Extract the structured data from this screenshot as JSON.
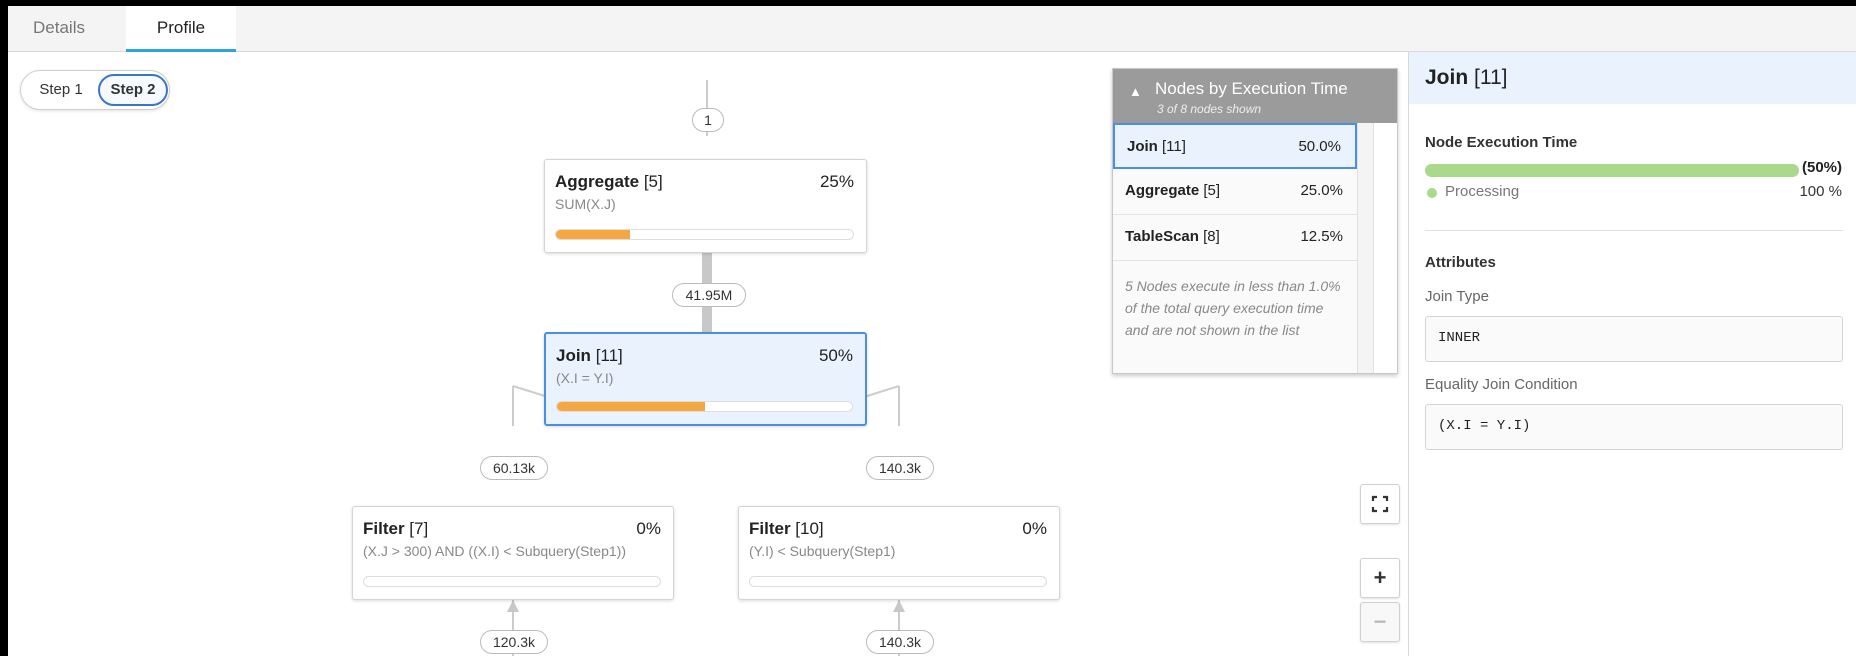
{
  "tabs": [
    {
      "label": "Details"
    },
    {
      "label": "Profile"
    }
  ],
  "steps": [
    {
      "label": "Step 1"
    },
    {
      "label": "Step 2"
    }
  ],
  "graph": {
    "root_label": "1",
    "nodes": {
      "aggregate": {
        "name": "Aggregate",
        "id": "[5]",
        "expr": "SUM(X.J)",
        "percent": "25%",
        "progress": 0.25
      },
      "join": {
        "name": "Join",
        "id": "[11]",
        "expr": "(X.I = Y.I)",
        "percent": "50%",
        "progress": 0.5
      },
      "filter7": {
        "name": "Filter",
        "id": "[7]",
        "expr": "(X.J > 300) AND ((X.I) < Subquery(Step1))",
        "percent": "0%",
        "progress": 0
      },
      "filter10": {
        "name": "Filter",
        "id": "[10]",
        "expr": "(Y.I) < Subquery(Step1)",
        "percent": "0%",
        "progress": 0
      }
    },
    "edges": {
      "join_to_aggregate": "41.95M",
      "filter7_to_join": "60.13k",
      "filter10_to_join": "140.3k",
      "below_filter7": "120.3k",
      "below_filter10": "140.3k"
    }
  },
  "execution_panel": {
    "title": "Nodes by Execution Time",
    "subtitle": "3 of 8 nodes shown",
    "rows": [
      {
        "name": "Join",
        "id": "[11]",
        "value": "50.0%"
      },
      {
        "name": "Aggregate",
        "id": "[5]",
        "value": "25.0%"
      },
      {
        "name": "TableScan",
        "id": "[8]",
        "value": "12.5%"
      }
    ],
    "note": "5 Nodes execute in less than 1.0% of the total query execution time and are not shown in the list"
  },
  "zoom": {
    "plus": "+",
    "minus": "−"
  },
  "details": {
    "node_name": "Join",
    "node_id": "[11]",
    "exec_title": "Node Execution Time",
    "exec_percent": "(50%)",
    "processing_label": "Processing",
    "processing_value": "100 %",
    "attributes_title": "Attributes",
    "join_type_label": "Join Type",
    "join_type_value": "INNER",
    "equality_label": "Equality Join Condition",
    "equality_value": "(X.I = Y.I)"
  },
  "colors": {
    "accent": "#2ea3dd",
    "selected_border": "#4a90e2",
    "progress_orange": "#f5a742",
    "exec_green": "#a9d98a"
  }
}
